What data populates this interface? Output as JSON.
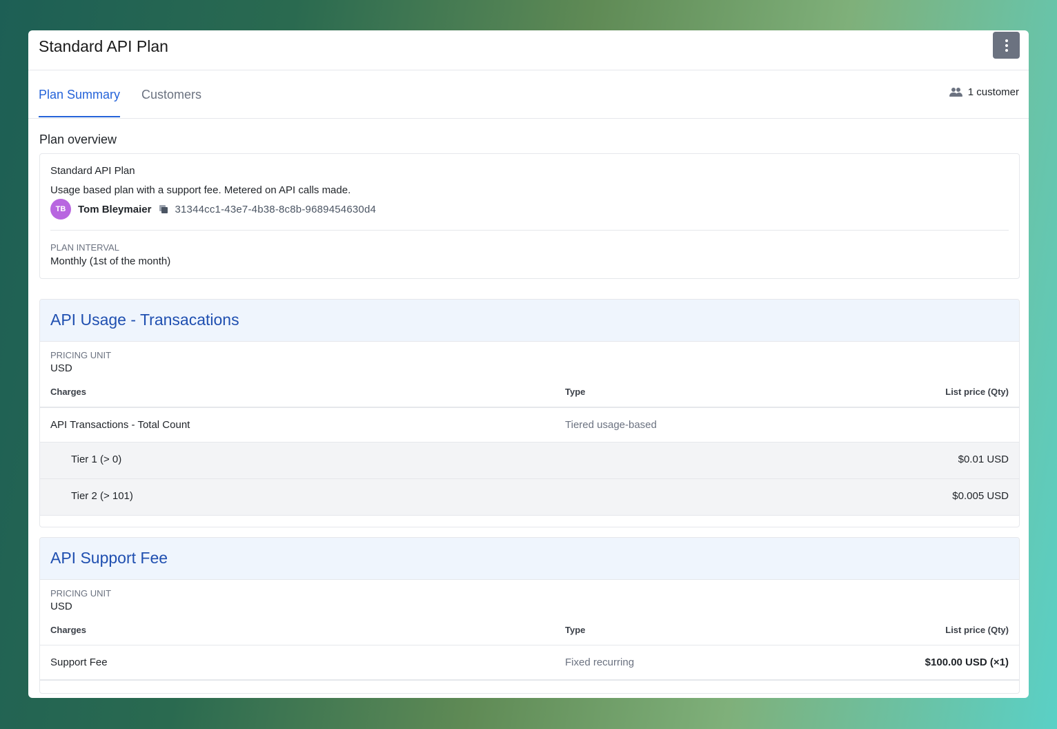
{
  "header": {
    "title": "Standard API Plan",
    "menu_icon": "kebab-menu-icon"
  },
  "tabs": [
    {
      "label": "Plan Summary",
      "active": true
    },
    {
      "label": "Customers",
      "active": false
    }
  ],
  "customer_count": "1 customer",
  "overview": {
    "section_label": "Plan overview",
    "name": "Standard API Plan",
    "description": "Usage based plan with a support fee. Metered on API calls made.",
    "owner_initials": "TB",
    "owner_name": "Tom Bleymaier",
    "plan_id": "31344cc1-43e7-4b38-8c8b-9689454630d4",
    "interval_label": "PLAN INTERVAL",
    "interval_value": "Monthly (1st of the month)"
  },
  "price_cards": [
    {
      "title": "API Usage - Transacations",
      "pricing_unit_label": "PRICING UNIT",
      "pricing_unit": "USD",
      "headers": {
        "charges": "Charges",
        "type": "Type",
        "price": "List price (Qty)"
      },
      "charge": {
        "name": "API Transactions - Total Count",
        "type": "Tiered usage-based",
        "price": ""
      },
      "tiers": [
        {
          "name": "Tier 1 (> 0)",
          "price": "$0.01 USD"
        },
        {
          "name": "Tier 2 (> 101)",
          "price": "$0.005 USD"
        }
      ]
    },
    {
      "title": "API Support Fee",
      "pricing_unit_label": "PRICING UNIT",
      "pricing_unit": "USD",
      "headers": {
        "charges": "Charges",
        "type": "Type",
        "price": "List price (Qty)"
      },
      "charge": {
        "name": "Support Fee",
        "type": "Fixed recurring",
        "price": "$100.00 USD (×1)"
      }
    }
  ],
  "colors": {
    "accent": "#2563d9",
    "card_title": "#1f4fb0",
    "avatar": "#b866e0"
  }
}
